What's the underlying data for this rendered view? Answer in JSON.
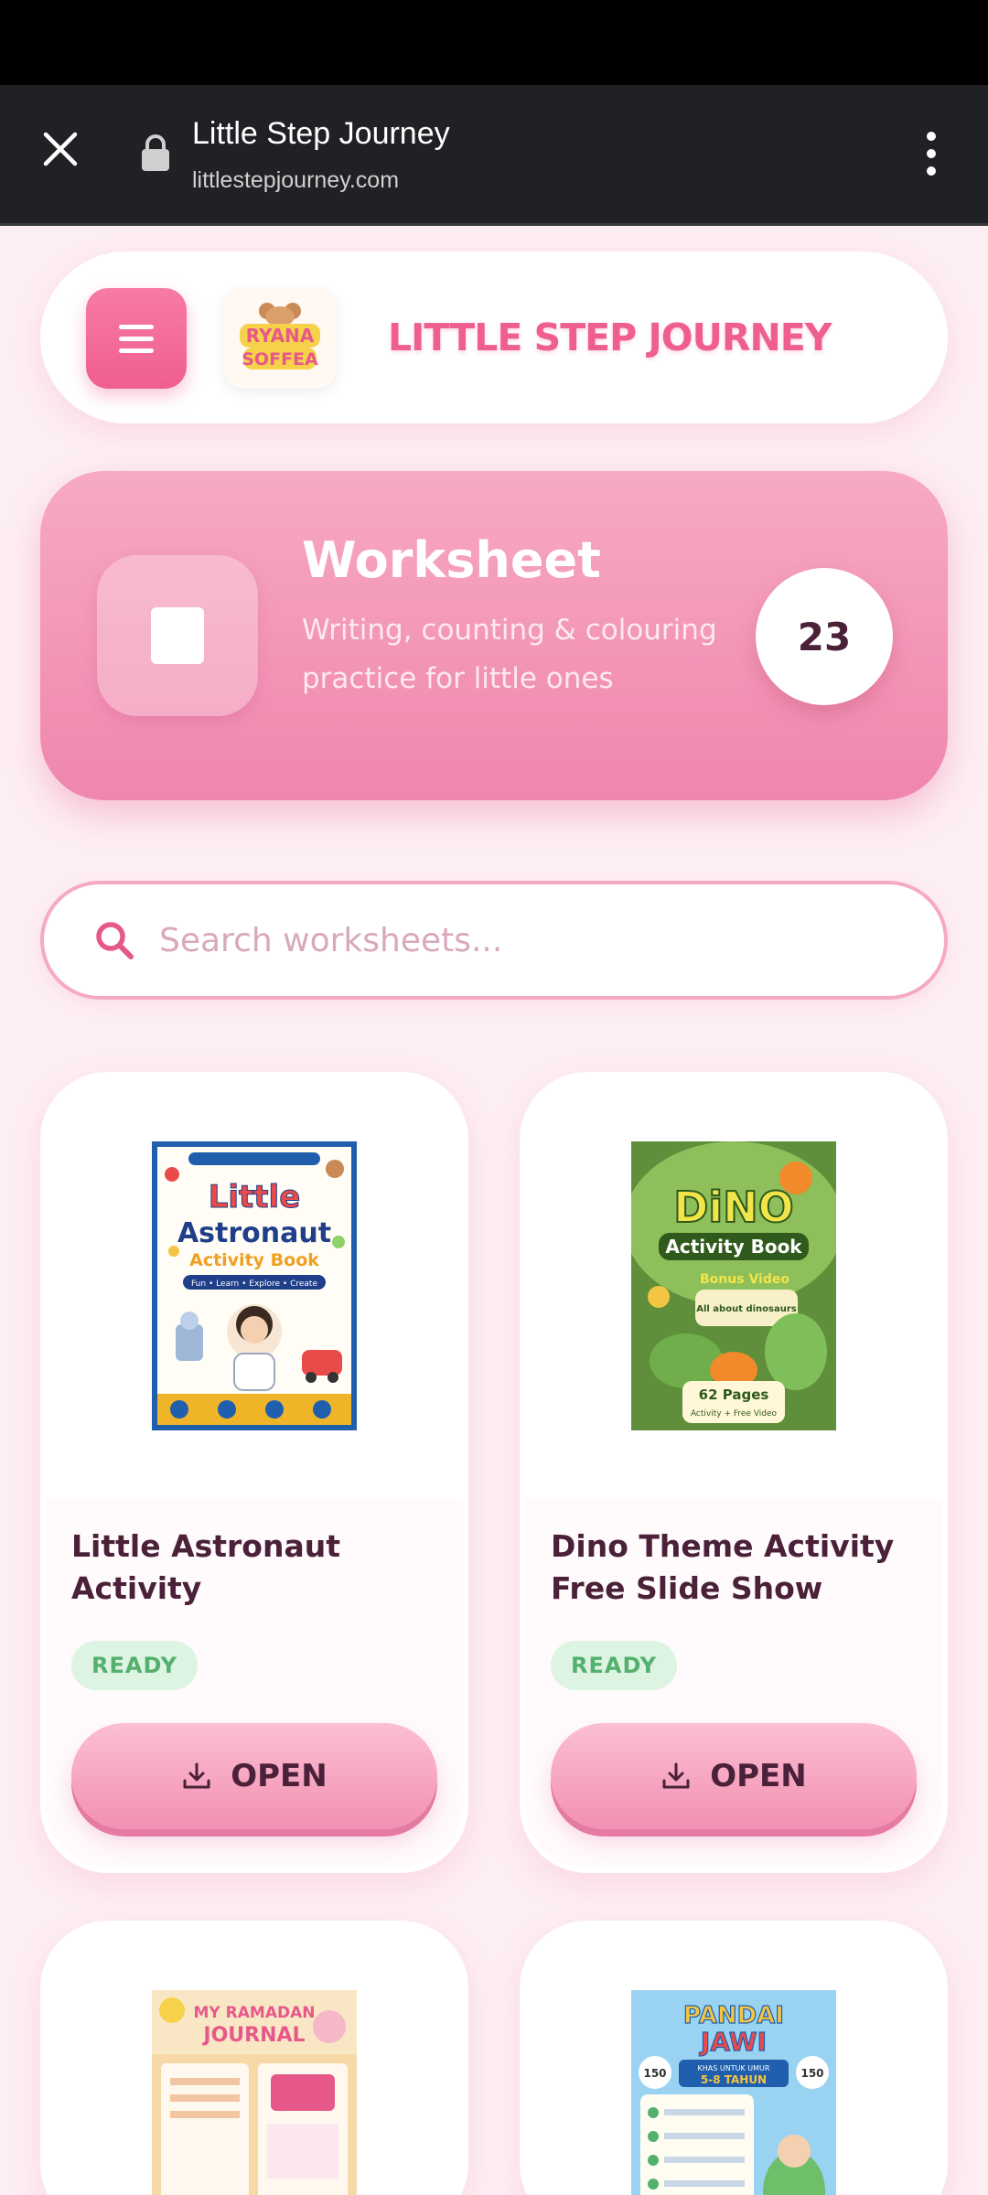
{
  "browser": {
    "title": "Little Step Journey",
    "url": "littlestepjourney.com"
  },
  "header": {
    "logo_text_line1": "RYANA",
    "logo_text_line2": "SOFFEA",
    "brand_name": "LITTLE STEP JOURNEY"
  },
  "hero": {
    "title": "Worksheet",
    "subtitle": "Writing, counting & colouring practice for little ones",
    "count": "23"
  },
  "search": {
    "placeholder": "Search worksheets..."
  },
  "cards": [
    {
      "title": "Little Astronaut Activity",
      "status": "READY",
      "button": "OPEN",
      "cover": {
        "line1": "Little",
        "line2": "Astronaut",
        "line3": "Activity Book",
        "tagline": "Fun • Learn • Explore • Create",
        "colors": {
          "bg": "#1f5fae",
          "panel": "#fffdf5",
          "accent": "#f0b429"
        }
      }
    },
    {
      "title": "Dino Theme Activity Free Slide Show",
      "status": "READY",
      "button": "OPEN",
      "cover": {
        "line1": "DiNO",
        "line2": "Activity Book",
        "line3": "Bonus Video",
        "line4": "All about dinosaurs",
        "footer_big": "62 Pages",
        "footer_small": "Activity + Free Video",
        "colors": {
          "bg": "#5f8f3a",
          "title": "#f2e54a",
          "accent": "#f08a2a"
        }
      }
    },
    {
      "cover": {
        "line1": "MY RAMADAN",
        "line2": "JOURNAL",
        "colors": {
          "bg": "#f7d9a8",
          "accent": "#e7588a"
        }
      }
    },
    {
      "cover": {
        "line1": "PANDAI",
        "line2": "JAWI",
        "line3": "KHAS UNTUK UMUR",
        "line4": "5-8 TAHUN",
        "badge": "150",
        "colors": {
          "bg": "#9ad3f1",
          "accent": "#f4c542"
        }
      }
    }
  ],
  "colors": {
    "primary_pink": "#ef5f8e",
    "hero_pink": "#f49ab9",
    "text_dark": "#4a2138",
    "ready_green": "#54b06e",
    "page_bg": "#fdeef3"
  }
}
